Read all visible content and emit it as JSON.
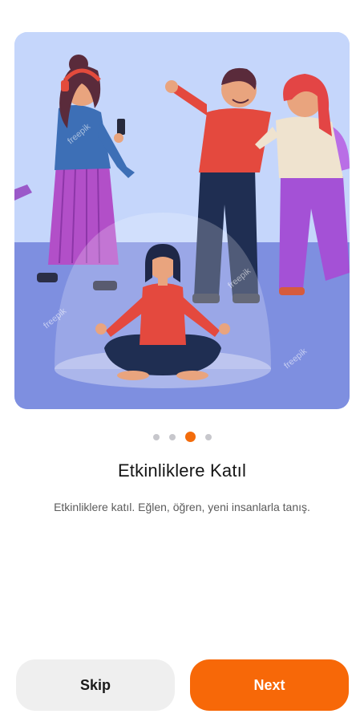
{
  "onboarding": {
    "title": "Etkinliklere Katıl",
    "subtitle": "Etkinliklere katıl. Eğlen, öğren, yeni insanlarla tanış.",
    "pagination": {
      "total": 4,
      "active_index": 2
    },
    "illustration": {
      "watermark": "freepik",
      "colors": {
        "sky": "#c5d6fb",
        "floor": "#7e8fe0",
        "bubble": "#ffffff"
      }
    }
  },
  "buttons": {
    "skip_label": "Skip",
    "next_label": "Next"
  },
  "colors": {
    "accent": "#f76808",
    "skip_bg": "#efefef",
    "text_dark": "#151515",
    "text_muted": "#5b5b5b"
  }
}
